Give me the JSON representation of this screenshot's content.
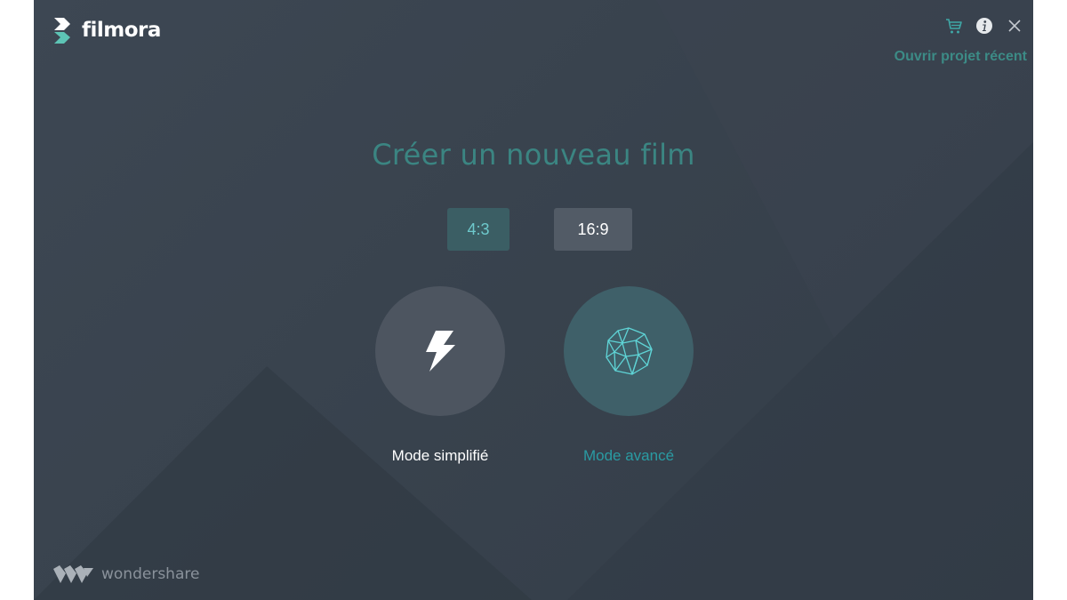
{
  "app": {
    "logo_text": "filmora",
    "brand_text": "wondershare"
  },
  "header": {
    "recent_project_label": "Ouvrir projet récent",
    "icons": [
      "cart-icon",
      "info-icon",
      "close-icon"
    ]
  },
  "main": {
    "title": "Créer un nouveau film",
    "aspect_ratios": [
      {
        "label": "4:3",
        "selected": true
      },
      {
        "label": "16:9",
        "selected": false
      }
    ],
    "modes": [
      {
        "label": "Mode simplifié",
        "icon": "lightning-icon",
        "selected": false
      },
      {
        "label": "Mode avancé",
        "icon": "geodesic-sphere-icon",
        "selected": true
      }
    ]
  },
  "colors": {
    "background": "#38424d",
    "accent_teal": "#3b8582",
    "advanced_label": "#2a9ba3",
    "ratio_selected_bg": "#3b5e64",
    "ratio_unselected_bg": "#525b66"
  }
}
